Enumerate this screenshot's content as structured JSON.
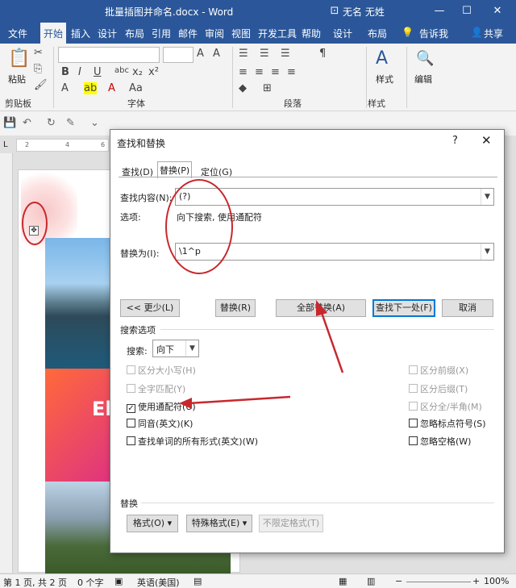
{
  "window": {
    "title": "批量插图并命名.docx - Word",
    "user": "无名 无姓",
    "controls": [
      "⊡",
      "—",
      "☐",
      "✕"
    ]
  },
  "ribbon_tabs": [
    {
      "label": "文件"
    },
    {
      "label": "开始"
    },
    {
      "label": "插入"
    },
    {
      "label": "设计"
    },
    {
      "label": "布局"
    },
    {
      "label": "引用"
    },
    {
      "label": "邮件"
    },
    {
      "label": "审阅"
    },
    {
      "label": "视图"
    },
    {
      "label": "开发工具"
    },
    {
      "label": "帮助"
    },
    {
      "label": "设计"
    },
    {
      "label": "布局"
    }
  ],
  "ribbon_right": {
    "lightbulb": "💡",
    "tell_me": "告诉我",
    "share": "共享"
  },
  "ribbon_groups": {
    "clipboard": "剪贴板",
    "paste": "粘贴",
    "font": "字体",
    "paragraph": "段落",
    "styles": "样式",
    "styles_btn": "样式",
    "editing": "编辑"
  },
  "ruler": {
    "ticks": [
      "L",
      "2",
      "2",
      "4",
      "6"
    ]
  },
  "dialog": {
    "title": "查找和替换",
    "help": "?",
    "close": "✕",
    "tabs": [
      "查找(D)",
      "替换(P)",
      "定位(G)"
    ],
    "find_label": "查找内容(N):",
    "find_value": "(?)",
    "options_label": "选项:",
    "options_value": "向下搜索, 使用通配符",
    "replace_label": "替换为(I):",
    "replace_value": "\\1^p",
    "buttons": {
      "less": "<< 更少(L)",
      "replace": "替换(R)",
      "replace_all": "全部替换(A)",
      "find_next": "查找下一处(F)",
      "cancel": "取消"
    },
    "search_options_title": "搜索选项",
    "search_label": "搜索:",
    "search_value": "向下",
    "left_checks": [
      {
        "label": "区分大小写(H)",
        "checked": false,
        "disabled": true
      },
      {
        "label": "全字匹配(Y)",
        "checked": false,
        "disabled": true
      },
      {
        "label": "使用通配符(U)",
        "checked": true,
        "disabled": false
      },
      {
        "label": "同音(英文)(K)",
        "checked": false,
        "disabled": false
      },
      {
        "label": "查找单词的所有形式(英文)(W)",
        "checked": false,
        "disabled": false
      }
    ],
    "right_checks": [
      {
        "label": "区分前缀(X)",
        "checked": false,
        "disabled": true
      },
      {
        "label": "区分后缀(T)",
        "checked": false,
        "disabled": true
      },
      {
        "label": "区分全/半角(M)",
        "checked": false,
        "disabled": true
      },
      {
        "label": "忽略标点符号(S)",
        "checked": false,
        "disabled": false
      },
      {
        "label": "忽略空格(W)",
        "checked": false,
        "disabled": false
      }
    ],
    "replace_section": "替换",
    "format_buttons": {
      "format": "格式(O) ▾",
      "special": "特殊格式(E) ▾",
      "no_format": "不限定格式(T)"
    },
    "checkmark": "✓"
  },
  "page": {
    "image_text": "El"
  },
  "statusbar": {
    "page": "第 1 页, 共 2 页",
    "words": "0 个字",
    "language": "英语(美国)",
    "zoom": "100%"
  },
  "colors": {
    "accent": "#2b579a",
    "annotation": "#c8282d"
  }
}
